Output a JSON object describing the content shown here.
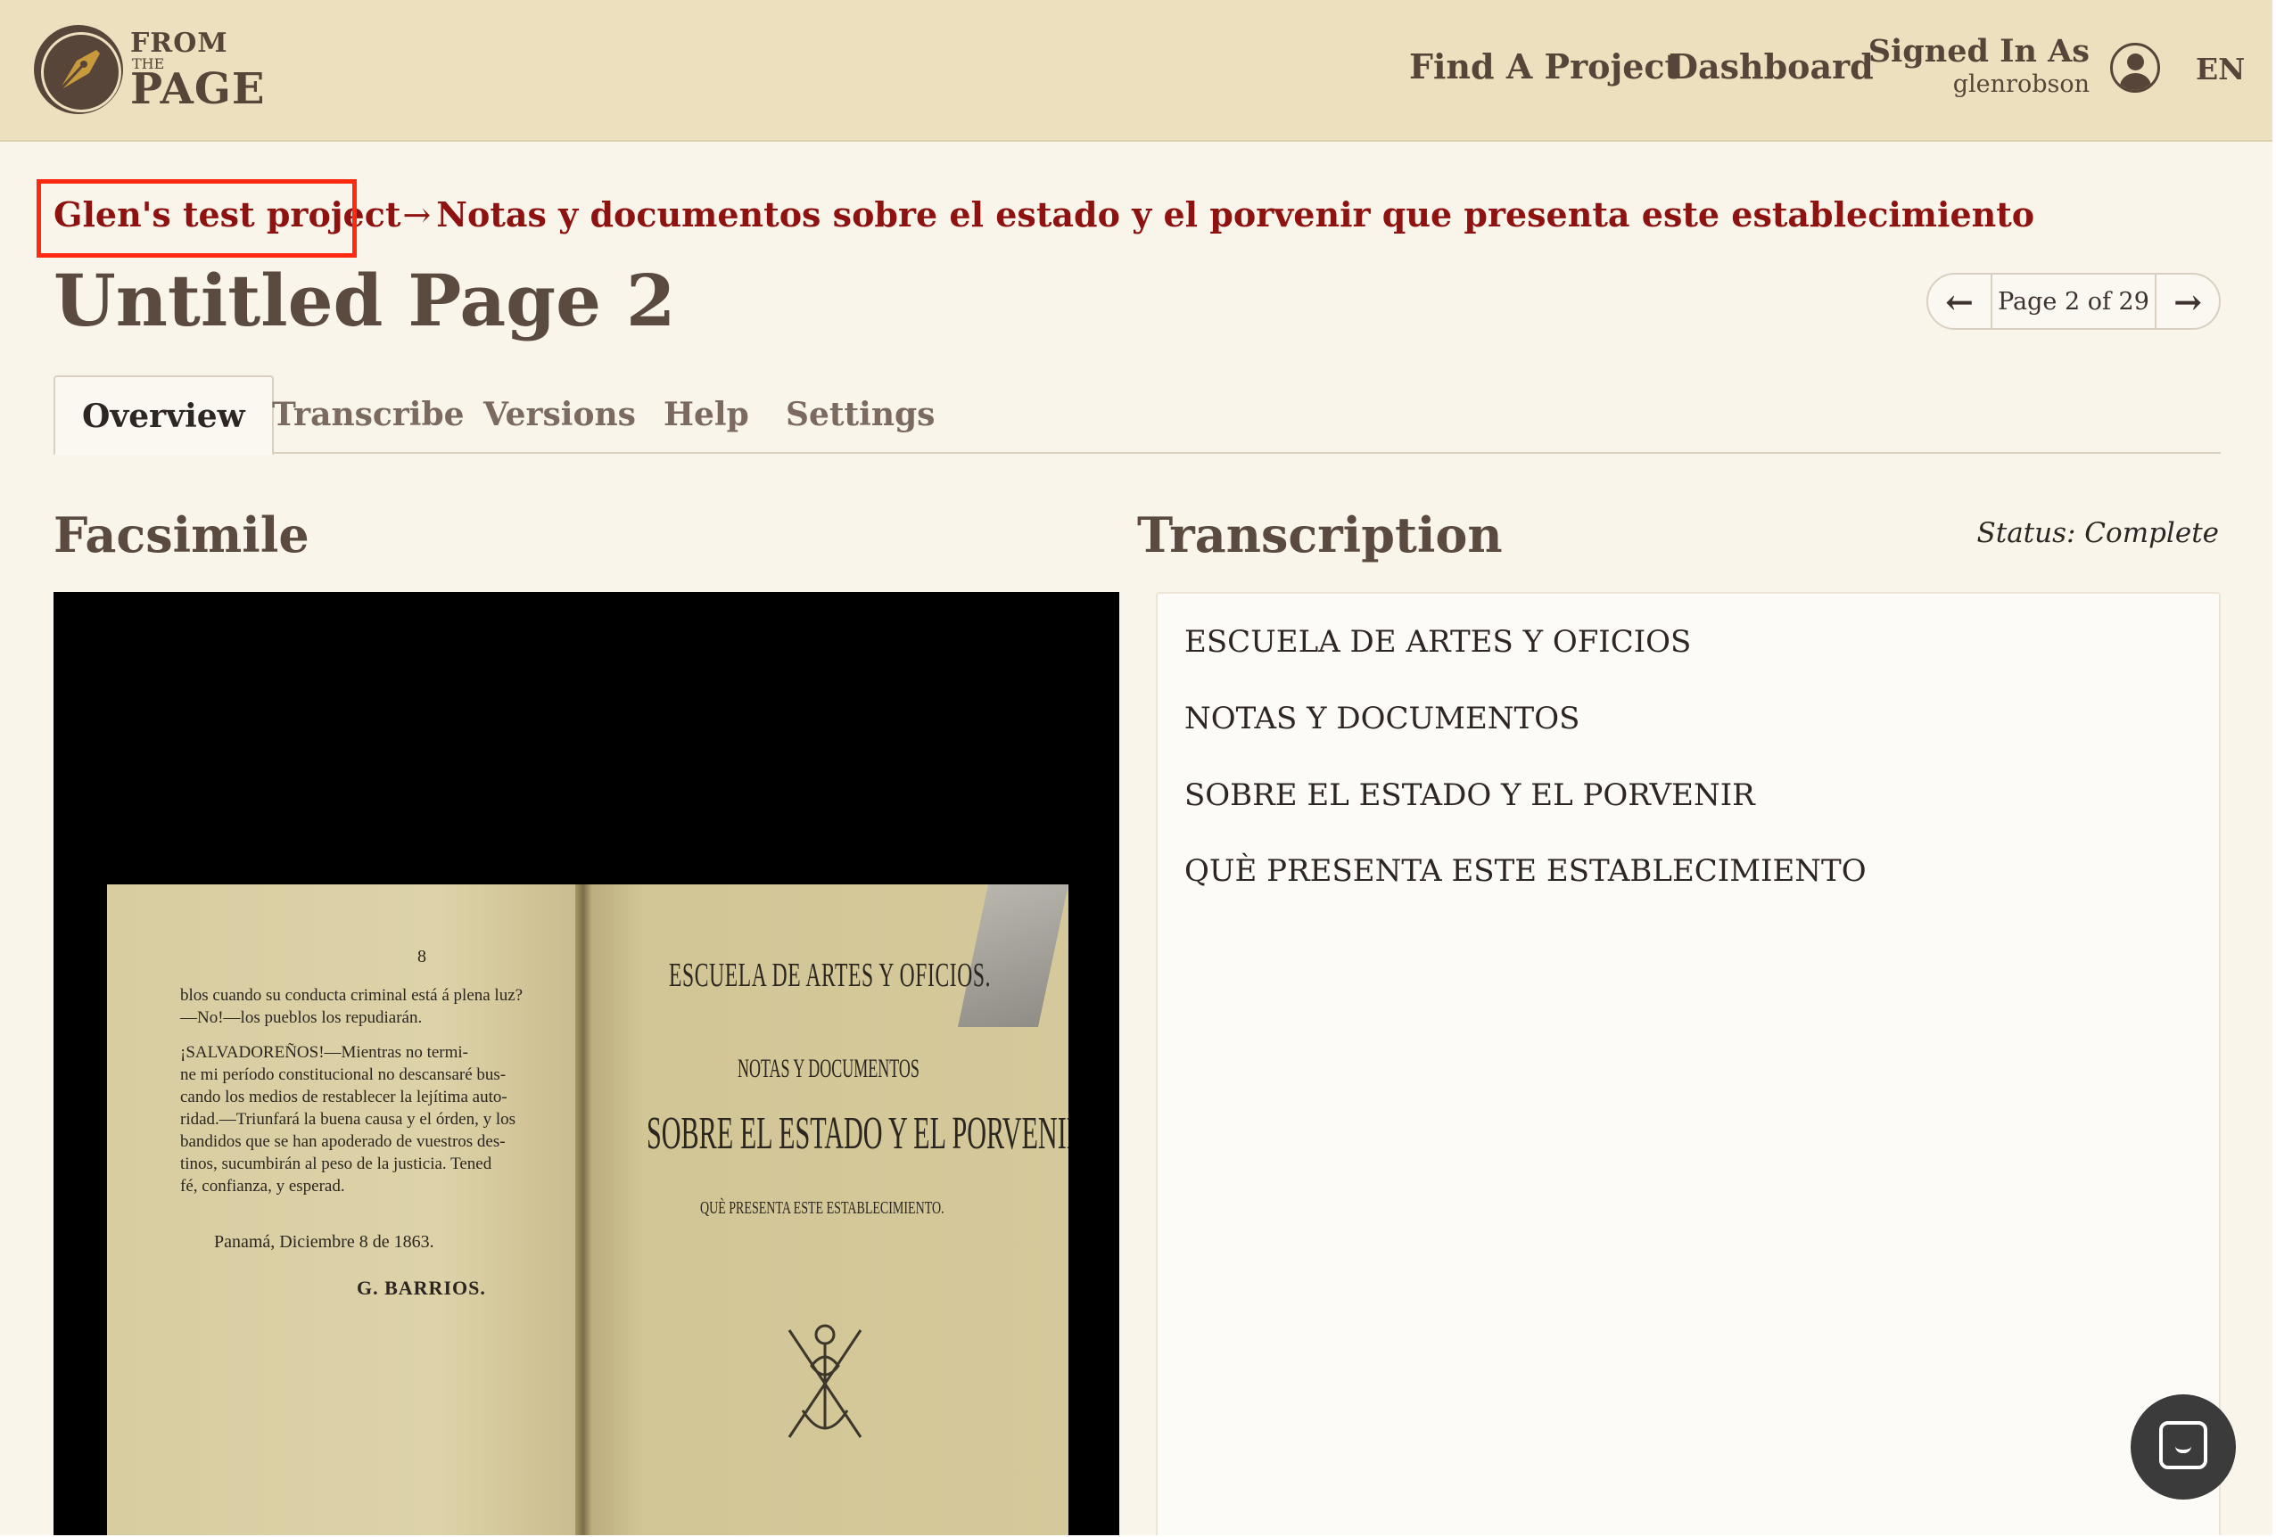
{
  "header": {
    "logo": {
      "from": "FROM",
      "the": "THE",
      "page": "PAGE"
    },
    "nav": {
      "find_project": "Find A Project",
      "dashboard": "Dashboard"
    },
    "signed_in_label": "Signed In As",
    "username": "glenrobson",
    "language": "EN"
  },
  "breadcrumb": {
    "project": "Glen's test project",
    "separator": "→",
    "work": "Notas y documentos sobre el estado y el porvenir que presenta este establecimiento"
  },
  "page_title": "Untitled Page 2",
  "pager": {
    "label": "Page 2 of 29",
    "prev_icon": "←",
    "next_icon": "→"
  },
  "tabs": [
    "Overview",
    "Transcribe",
    "Versions",
    "Help",
    "Settings"
  ],
  "facsimile": {
    "heading": "Facsimile",
    "image": {
      "page_number": "8",
      "left_text": [
        "blos cuando su conducta criminal está á plena luz?",
        "—No!—los pueblos los repudiarán.",
        "¡SALVADOREÑOS!—Mientras no termi-",
        "ne mi período constitucional no descansaré bus-",
        "cando los medios de restablecer la lejítima auto-",
        "ridad.—Triunfará la buena causa y el órden, y los",
        "bandidos que se han apoderado de vuestros des-",
        "tinos, sucumbirán al peso de la justicia. Tened",
        "fé, confianza, y esperad."
      ],
      "place_date": "Panamá, Diciembre 8 de 1863.",
      "signature": "G. BARRIOS.",
      "right_title": "ESCUELA DE ARTES Y OFICIOS.",
      "right_sub1": "NOTAS Y DOCUMENTOS",
      "right_sub2": "SOBRE EL ESTADO Y EL PORVENIR",
      "right_sub3": "QUÈ PRESENTA ESTE ESTABLECIMIENTO."
    }
  },
  "transcription": {
    "heading": "Transcription",
    "status": "Status: Complete",
    "lines": [
      "ESCUELA DE ARTES Y OFICIOS",
      "NOTAS Y DOCUMENTOS",
      "SOBRE EL ESTADO Y EL PORVENIR",
      "QUÈ PRESENTA ESTE ESTABLECIMIENTO"
    ]
  },
  "icons": {
    "logo": "pen-nib-icon",
    "user": "user-avatar-icon",
    "chat": "chat-bubble-icon"
  },
  "colors": {
    "header_bg": "#ede0bf",
    "page_bg": "#f9f5eb",
    "link": "#8e1210",
    "highlight": "#ff2a10"
  }
}
